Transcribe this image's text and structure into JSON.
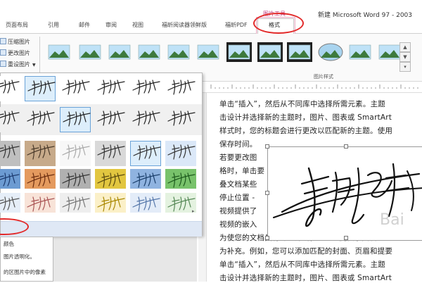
{
  "app": {
    "title": "新建 Microsoft Word 97 - 2003",
    "context_group": "图片工具"
  },
  "tabs": [
    {
      "label": "页面布局"
    },
    {
      "label": "引用"
    },
    {
      "label": "邮件"
    },
    {
      "label": "审阅"
    },
    {
      "label": "视图"
    },
    {
      "label": "福昕阅读器领鲜版"
    },
    {
      "label": "福昕PDF"
    },
    {
      "label": "格式"
    }
  ],
  "ribbon": {
    "adjust": [
      {
        "label": "压缩图片"
      },
      {
        "label": "更改图片"
      },
      {
        "label": "重设图片"
      }
    ],
    "styles_group_label": "图片样式"
  },
  "recolor_menu": {
    "items": [
      {
        "label": "颜色"
      },
      {
        "label": "图片透明化。"
      },
      {
        "label": "的区图片中的像素"
      }
    ]
  },
  "document": {
    "lines": [
      "单击“插入”，然后从不同库中选择所需元素。主题",
      "击设计并选择新的主题时，图片、图表或 SmartArt",
      "样式时，您的标题会进行更改以匹配新的主题。使用",
      "保存时间。",
      "若要更改图",
      "格时，单击要",
      "叠文档某些",
      "停止位置 -",
      "视频提供了",
      "视频的嵌入",
      "为使您的文档具有专业外观，Word 提供了页眉、",
      "为补充。例如，您可以添加匹配的封面、页眉和提要",
      "单击“插入”，然后从不同库中选择所需元素。主题",
      "击设计并选择新的主题时，图片、图表或 SmartArt"
    ],
    "watermark": "Bai"
  },
  "colors": {
    "accent_pink": "#c0387a",
    "highlight_red": "#e22a2a",
    "selection_blue": "#6aa3d8"
  }
}
